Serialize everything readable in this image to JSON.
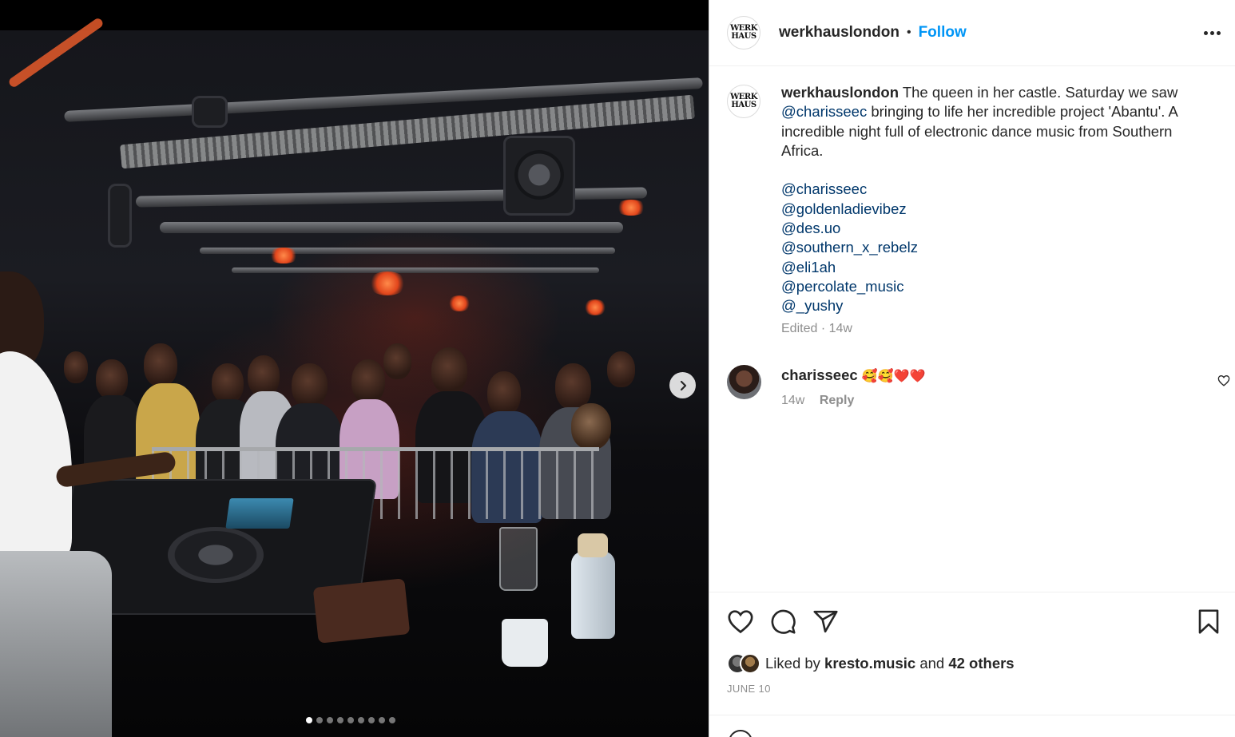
{
  "post": {
    "username": "werkhauslondon",
    "logo_text": [
      "WERK",
      "HAUS"
    ],
    "separator": "•",
    "follow_label": "Follow",
    "caption_lines": [
      "The queen in her castle. Saturday we saw",
      "bringing to life her incredible project 'Abantu'. A",
      "incredible night full of electronic dance music from Southern",
      "Africa."
    ],
    "caption_mention": "@charisseec",
    "mentions": [
      "@charisseec",
      "@goldenladievibez",
      "@des.uo",
      "@southern_x_rebelz",
      "@eli1ah",
      "@percolate_music",
      "@_yushy"
    ],
    "caption_meta": "Edited · 14w"
  },
  "comment": {
    "username": "charisseec",
    "emoji": "🥰🥰❤️❤️",
    "age": "14w",
    "reply_label": "Reply"
  },
  "engagement": {
    "liked_by_prefix": "Liked by",
    "liked_by_user": "kresto.music",
    "and_label": "and",
    "others": "42 others",
    "date": "JUNE 10"
  },
  "carousel": {
    "total_slides": 9,
    "active_index": 0
  },
  "icons": {
    "like": "heart-icon",
    "comment": "comment-bubble-icon",
    "share": "paper-plane-icon",
    "save": "bookmark-icon",
    "next": "chevron-right-icon",
    "more": "more-horizontal-icon"
  },
  "colors": {
    "link_blue": "#0095f6",
    "mention_blue": "#00376b",
    "muted_gray": "#8e8e8e",
    "text": "#262626"
  }
}
